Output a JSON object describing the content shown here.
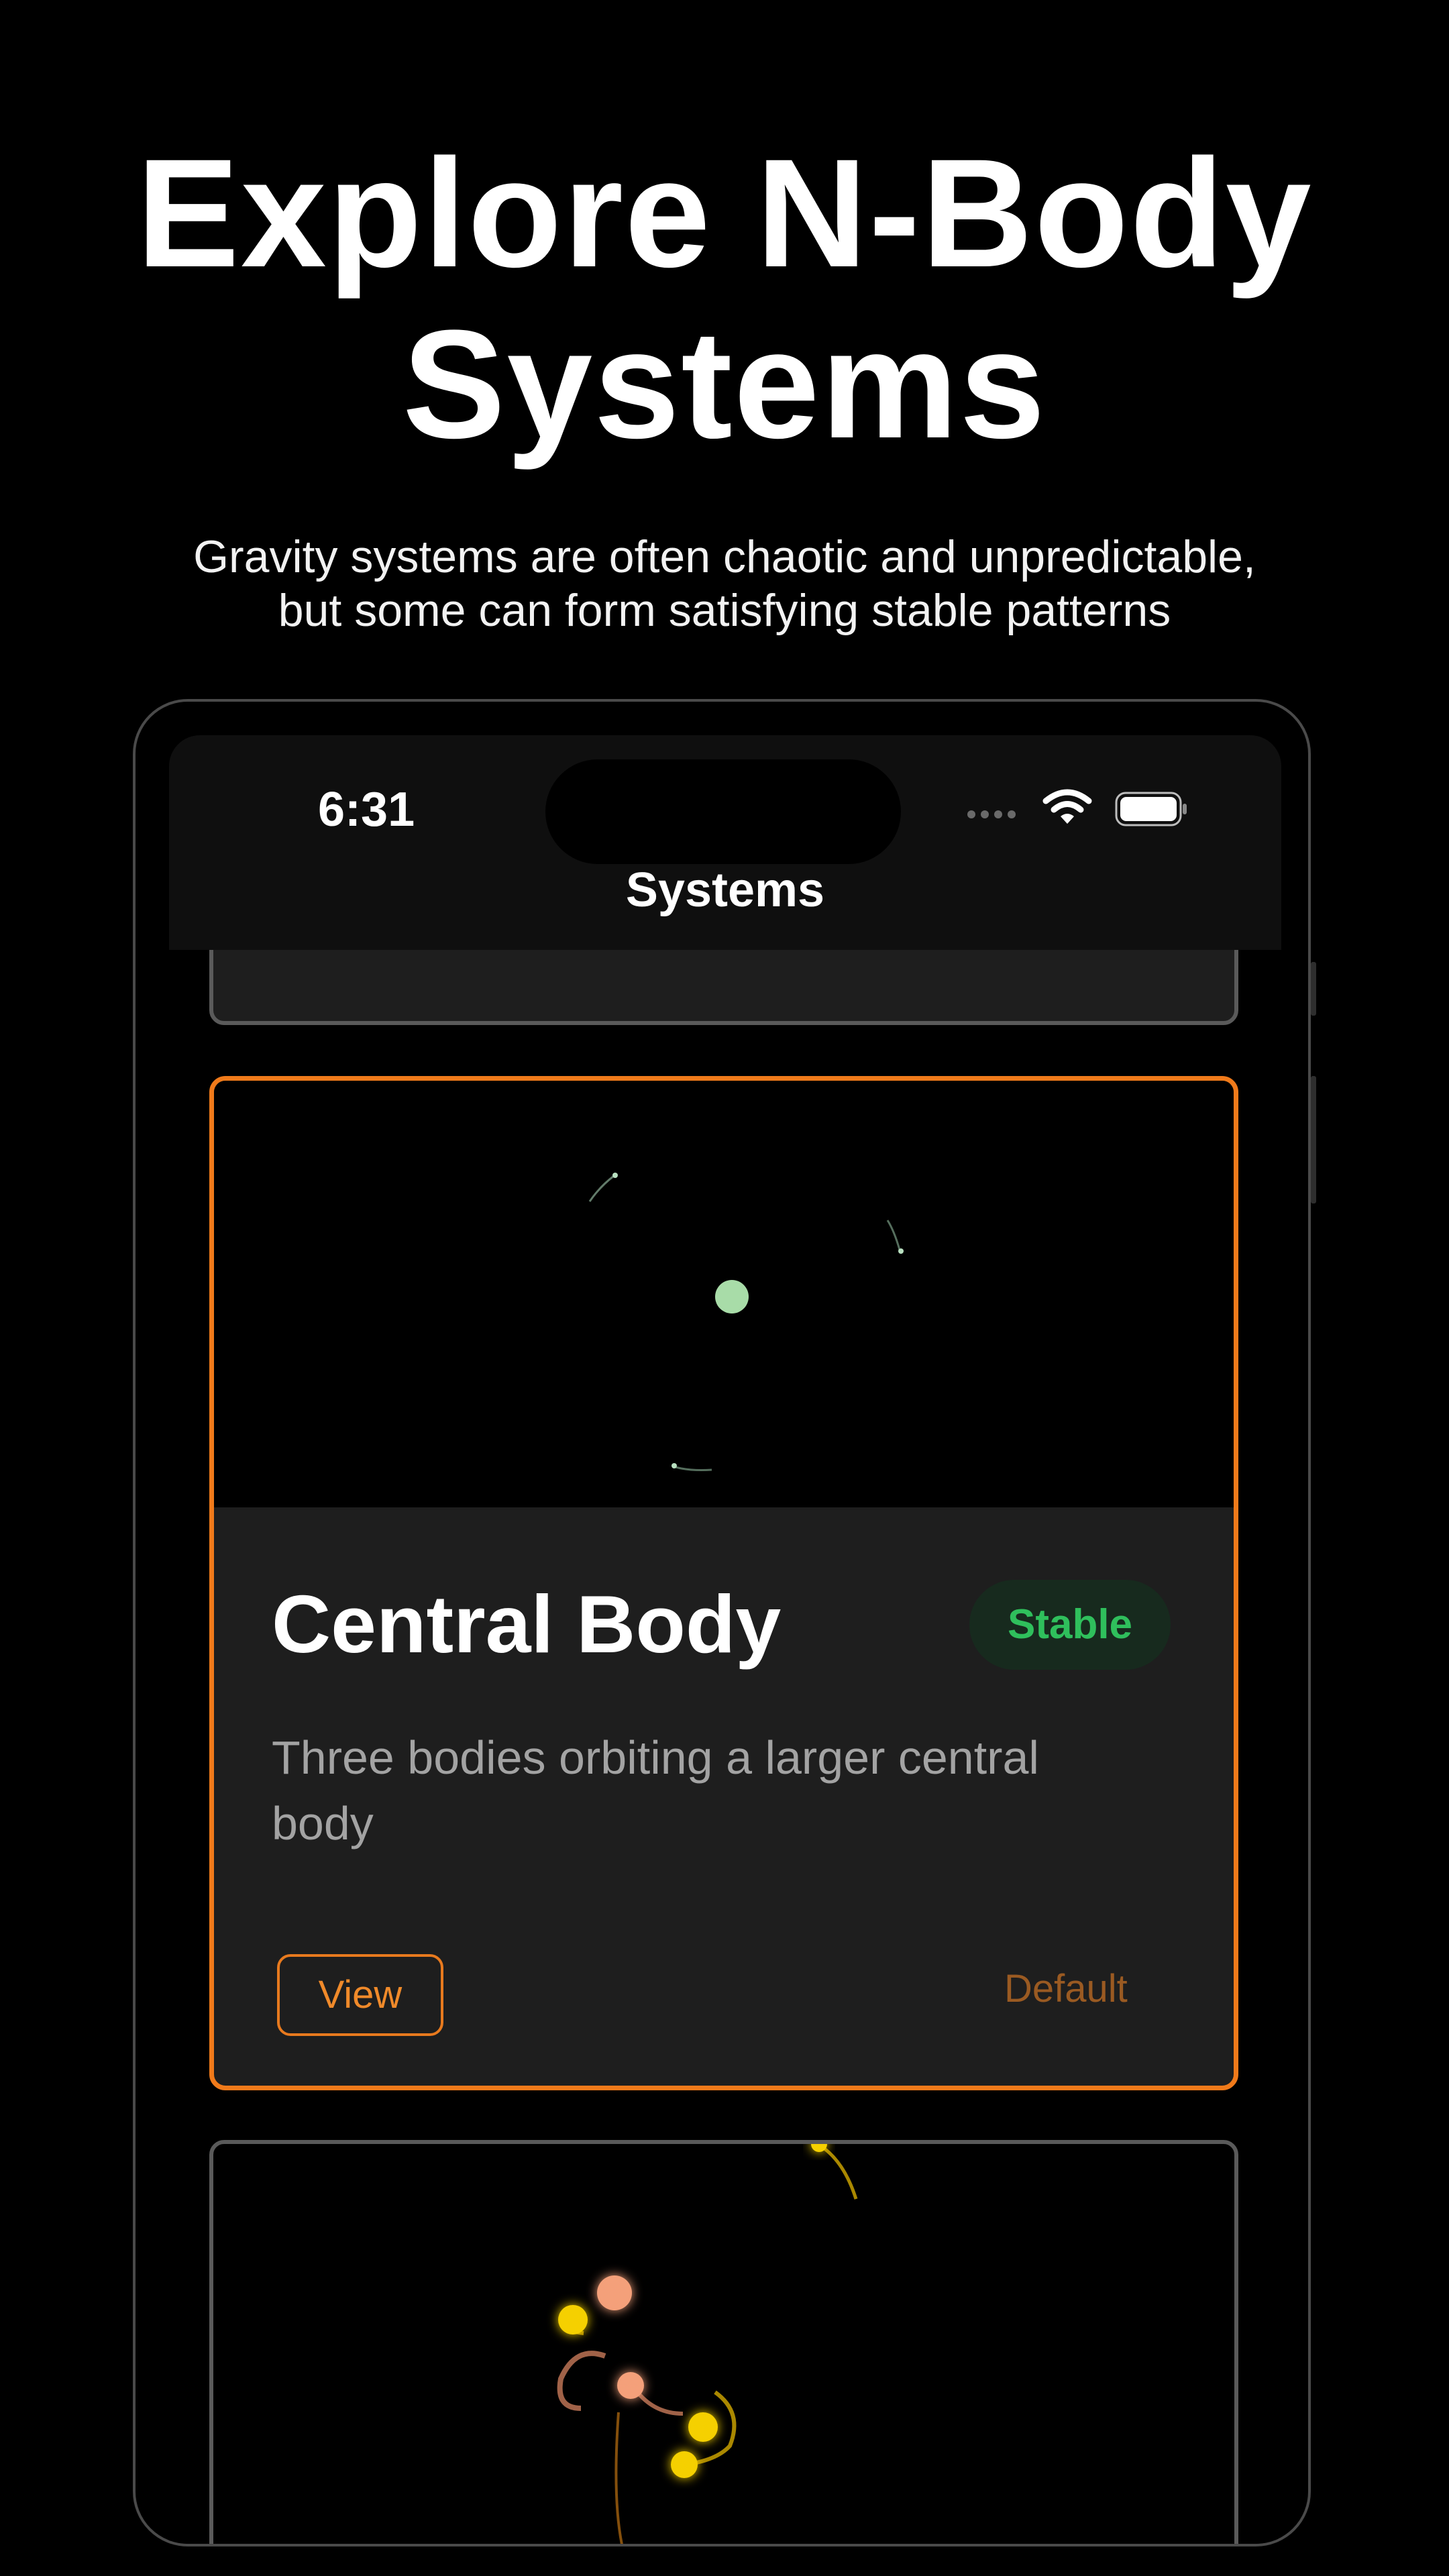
{
  "hero": {
    "title_line1": "Explore N-Body",
    "title_line2": "Systems",
    "subtitle_line1": "Gravity systems are often chaotic and unpredictable,",
    "subtitle_line2": "but some can form satisfying stable patterns"
  },
  "status_bar": {
    "time": "6:31"
  },
  "nav": {
    "title": "Systems"
  },
  "card": {
    "title": "Central Body",
    "badge": "Stable",
    "description": "Three bodies orbiting a larger central body",
    "view_label": "View",
    "tag_label": "Default"
  },
  "colors": {
    "accent": "#f07a1a",
    "stable_green": "#2fbf5c",
    "central_body": "#a8dca8",
    "body_yellow": "#f5d000",
    "body_salmon": "#f4a07a"
  },
  "icons": [
    "wifi-icon",
    "battery-icon",
    "cellular-signal-icon"
  ]
}
